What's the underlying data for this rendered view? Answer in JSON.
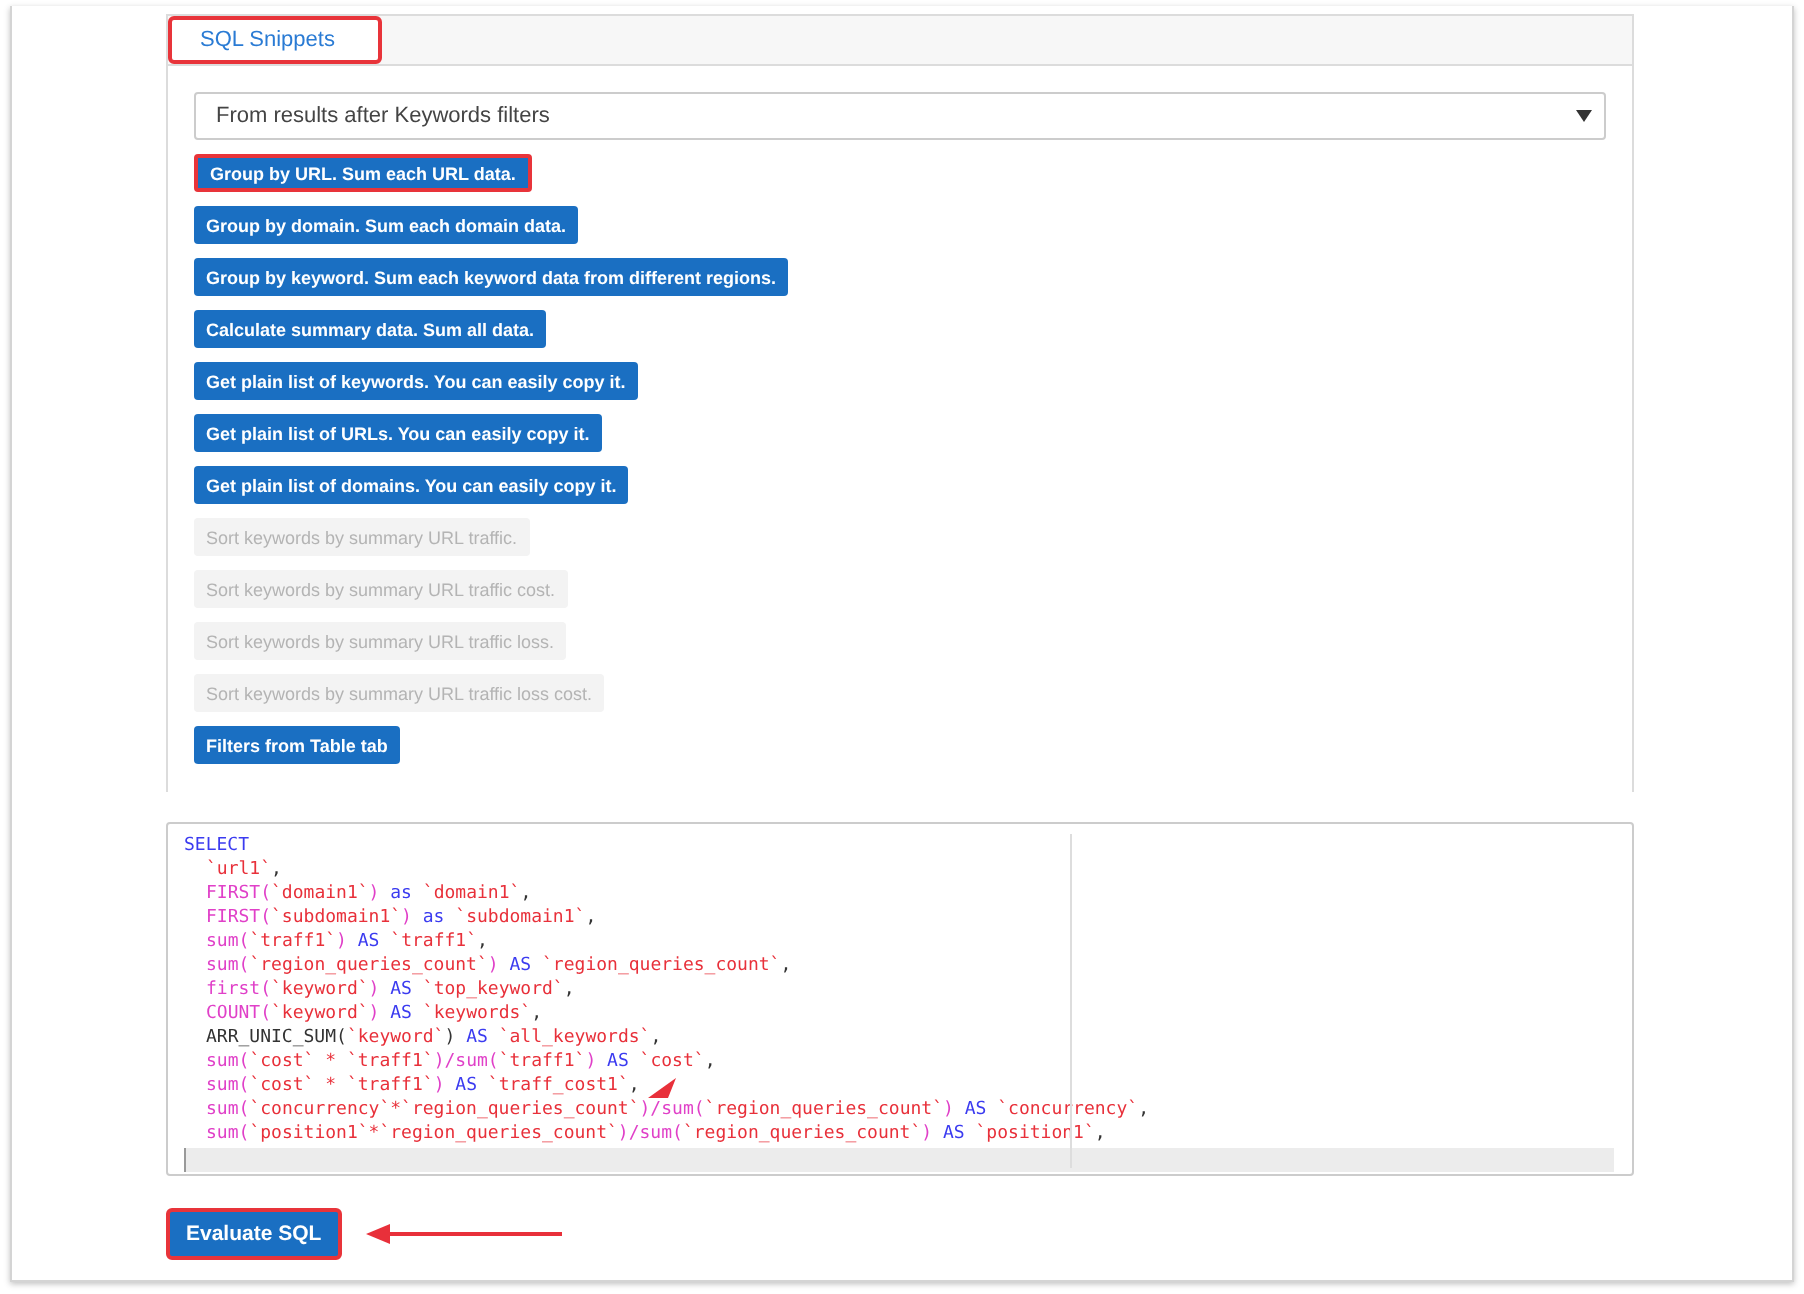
{
  "tabs": [
    {
      "label": "SQL Snippets",
      "selected": true,
      "highlighted": true
    }
  ],
  "source_select": {
    "value": "From results after Keywords filters"
  },
  "snippets": [
    {
      "label": "Group by URL. Sum each URL data.",
      "disabled": false,
      "highlighted": true
    },
    {
      "label": "Group by domain. Sum each domain data.",
      "disabled": false,
      "highlighted": false
    },
    {
      "label": "Group by keyword. Sum each keyword data from different regions.",
      "disabled": false,
      "highlighted": false
    },
    {
      "label": "Calculate summary data. Sum all data.",
      "disabled": false,
      "highlighted": false
    },
    {
      "label": "Get plain list of keywords. You can easily copy it.",
      "disabled": false,
      "highlighted": false
    },
    {
      "label": "Get plain list of URLs. You can easily copy it.",
      "disabled": false,
      "highlighted": false
    },
    {
      "label": "Get plain list of domains. You can easily copy it.",
      "disabled": false,
      "highlighted": false
    },
    {
      "label": "Sort keywords by summary URL traffic.",
      "disabled": true,
      "highlighted": false
    },
    {
      "label": "Sort keywords by summary URL traffic cost.",
      "disabled": true,
      "highlighted": false
    },
    {
      "label": "Sort keywords by summary URL traffic loss.",
      "disabled": true,
      "highlighted": false
    },
    {
      "label": "Sort keywords by summary URL traffic loss cost.",
      "disabled": true,
      "highlighted": false
    },
    {
      "label": "Filters from Table tab",
      "disabled": false,
      "highlighted": false
    }
  ],
  "editor": {
    "lines": [
      {
        "indented": false,
        "tokens": [
          {
            "kind": "kw",
            "text": "SELECT"
          }
        ]
      },
      {
        "indented": true,
        "tokens": [
          {
            "kind": "name",
            "text": "`url1`"
          },
          {
            "kind": "text",
            "text": ","
          }
        ]
      },
      {
        "indented": true,
        "tokens": [
          {
            "kind": "fn",
            "text": "FIRST("
          },
          {
            "kind": "name",
            "text": "`domain1`"
          },
          {
            "kind": "fn",
            "text": ")"
          },
          {
            "kind": "kw",
            "text": " as "
          },
          {
            "kind": "name",
            "text": "`domain1`"
          },
          {
            "kind": "text",
            "text": ","
          }
        ]
      },
      {
        "indented": true,
        "tokens": [
          {
            "kind": "fn",
            "text": "FIRST("
          },
          {
            "kind": "name",
            "text": "`subdomain1`"
          },
          {
            "kind": "fn",
            "text": ")"
          },
          {
            "kind": "kw",
            "text": " as "
          },
          {
            "kind": "name",
            "text": "`subdomain1`"
          },
          {
            "kind": "text",
            "text": ","
          }
        ]
      },
      {
        "indented": true,
        "tokens": [
          {
            "kind": "fn",
            "text": "sum("
          },
          {
            "kind": "name",
            "text": "`traff1`"
          },
          {
            "kind": "fn",
            "text": ")"
          },
          {
            "kind": "kw",
            "text": " AS "
          },
          {
            "kind": "name",
            "text": "`traff1`"
          },
          {
            "kind": "text",
            "text": ","
          }
        ]
      },
      {
        "indented": true,
        "tokens": [
          {
            "kind": "fn",
            "text": "sum("
          },
          {
            "kind": "name",
            "text": "`region_queries_count`"
          },
          {
            "kind": "fn",
            "text": ")"
          },
          {
            "kind": "kw",
            "text": " AS "
          },
          {
            "kind": "name",
            "text": "`region_queries_count`"
          },
          {
            "kind": "text",
            "text": ","
          }
        ]
      },
      {
        "indented": true,
        "tokens": [
          {
            "kind": "fn",
            "text": "first("
          },
          {
            "kind": "name",
            "text": "`keyword`"
          },
          {
            "kind": "fn",
            "text": ")"
          },
          {
            "kind": "kw",
            "text": " AS "
          },
          {
            "kind": "name",
            "text": "`top_keyword`"
          },
          {
            "kind": "text",
            "text": ","
          }
        ]
      },
      {
        "indented": true,
        "tokens": [
          {
            "kind": "fn",
            "text": "COUNT("
          },
          {
            "kind": "name",
            "text": "`keyword`"
          },
          {
            "kind": "fn",
            "text": ")"
          },
          {
            "kind": "kw",
            "text": " AS "
          },
          {
            "kind": "name",
            "text": "`keywords`"
          },
          {
            "kind": "text",
            "text": ","
          }
        ]
      },
      {
        "indented": true,
        "tokens": [
          {
            "kind": "text",
            "text": "ARR_UNIC_SUM("
          },
          {
            "kind": "name",
            "text": "`keyword`"
          },
          {
            "kind": "text",
            "text": ")"
          },
          {
            "kind": "kw",
            "text": " AS "
          },
          {
            "kind": "name",
            "text": "`all_keywords`"
          },
          {
            "kind": "text",
            "text": ","
          }
        ]
      },
      {
        "indented": true,
        "tokens": [
          {
            "kind": "fn",
            "text": "sum("
          },
          {
            "kind": "name",
            "text": "`cost` * `traff1`"
          },
          {
            "kind": "fn",
            "text": ")/sum("
          },
          {
            "kind": "name",
            "text": "`traff1`"
          },
          {
            "kind": "fn",
            "text": ")"
          },
          {
            "kind": "kw",
            "text": " AS "
          },
          {
            "kind": "name",
            "text": "`cost`"
          },
          {
            "kind": "text",
            "text": ","
          }
        ]
      },
      {
        "indented": true,
        "tokens": [
          {
            "kind": "fn",
            "text": "sum("
          },
          {
            "kind": "name",
            "text": "`cost` * `traff1`"
          },
          {
            "kind": "fn",
            "text": ")"
          },
          {
            "kind": "kw",
            "text": " AS "
          },
          {
            "kind": "name",
            "text": "`traff_cost1`"
          },
          {
            "kind": "text",
            "text": ","
          }
        ]
      },
      {
        "indented": true,
        "tokens": [
          {
            "kind": "fn",
            "text": "sum("
          },
          {
            "kind": "name",
            "text": "`concurrency`*`region_queries_count`"
          },
          {
            "kind": "fn",
            "text": ")/sum("
          },
          {
            "kind": "name",
            "text": "`region_queries_count`"
          },
          {
            "kind": "fn",
            "text": ")"
          },
          {
            "kind": "kw",
            "text": " AS "
          },
          {
            "kind": "name",
            "text": "`concurrency`"
          },
          {
            "kind": "text",
            "text": ","
          }
        ]
      },
      {
        "indented": true,
        "tokens": [
          {
            "kind": "fn",
            "text": "sum("
          },
          {
            "kind": "name",
            "text": "`position1`*`region_queries_count`"
          },
          {
            "kind": "fn",
            "text": ")/sum("
          },
          {
            "kind": "name",
            "text": "`region_queries_count`"
          },
          {
            "kind": "fn",
            "text": ")"
          },
          {
            "kind": "kw",
            "text": " AS "
          },
          {
            "kind": "name",
            "text": "`position1`"
          },
          {
            "kind": "text",
            "text": ","
          }
        ]
      }
    ]
  },
  "evaluate_button": {
    "label": "Evaluate SQL",
    "highlighted": true
  }
}
